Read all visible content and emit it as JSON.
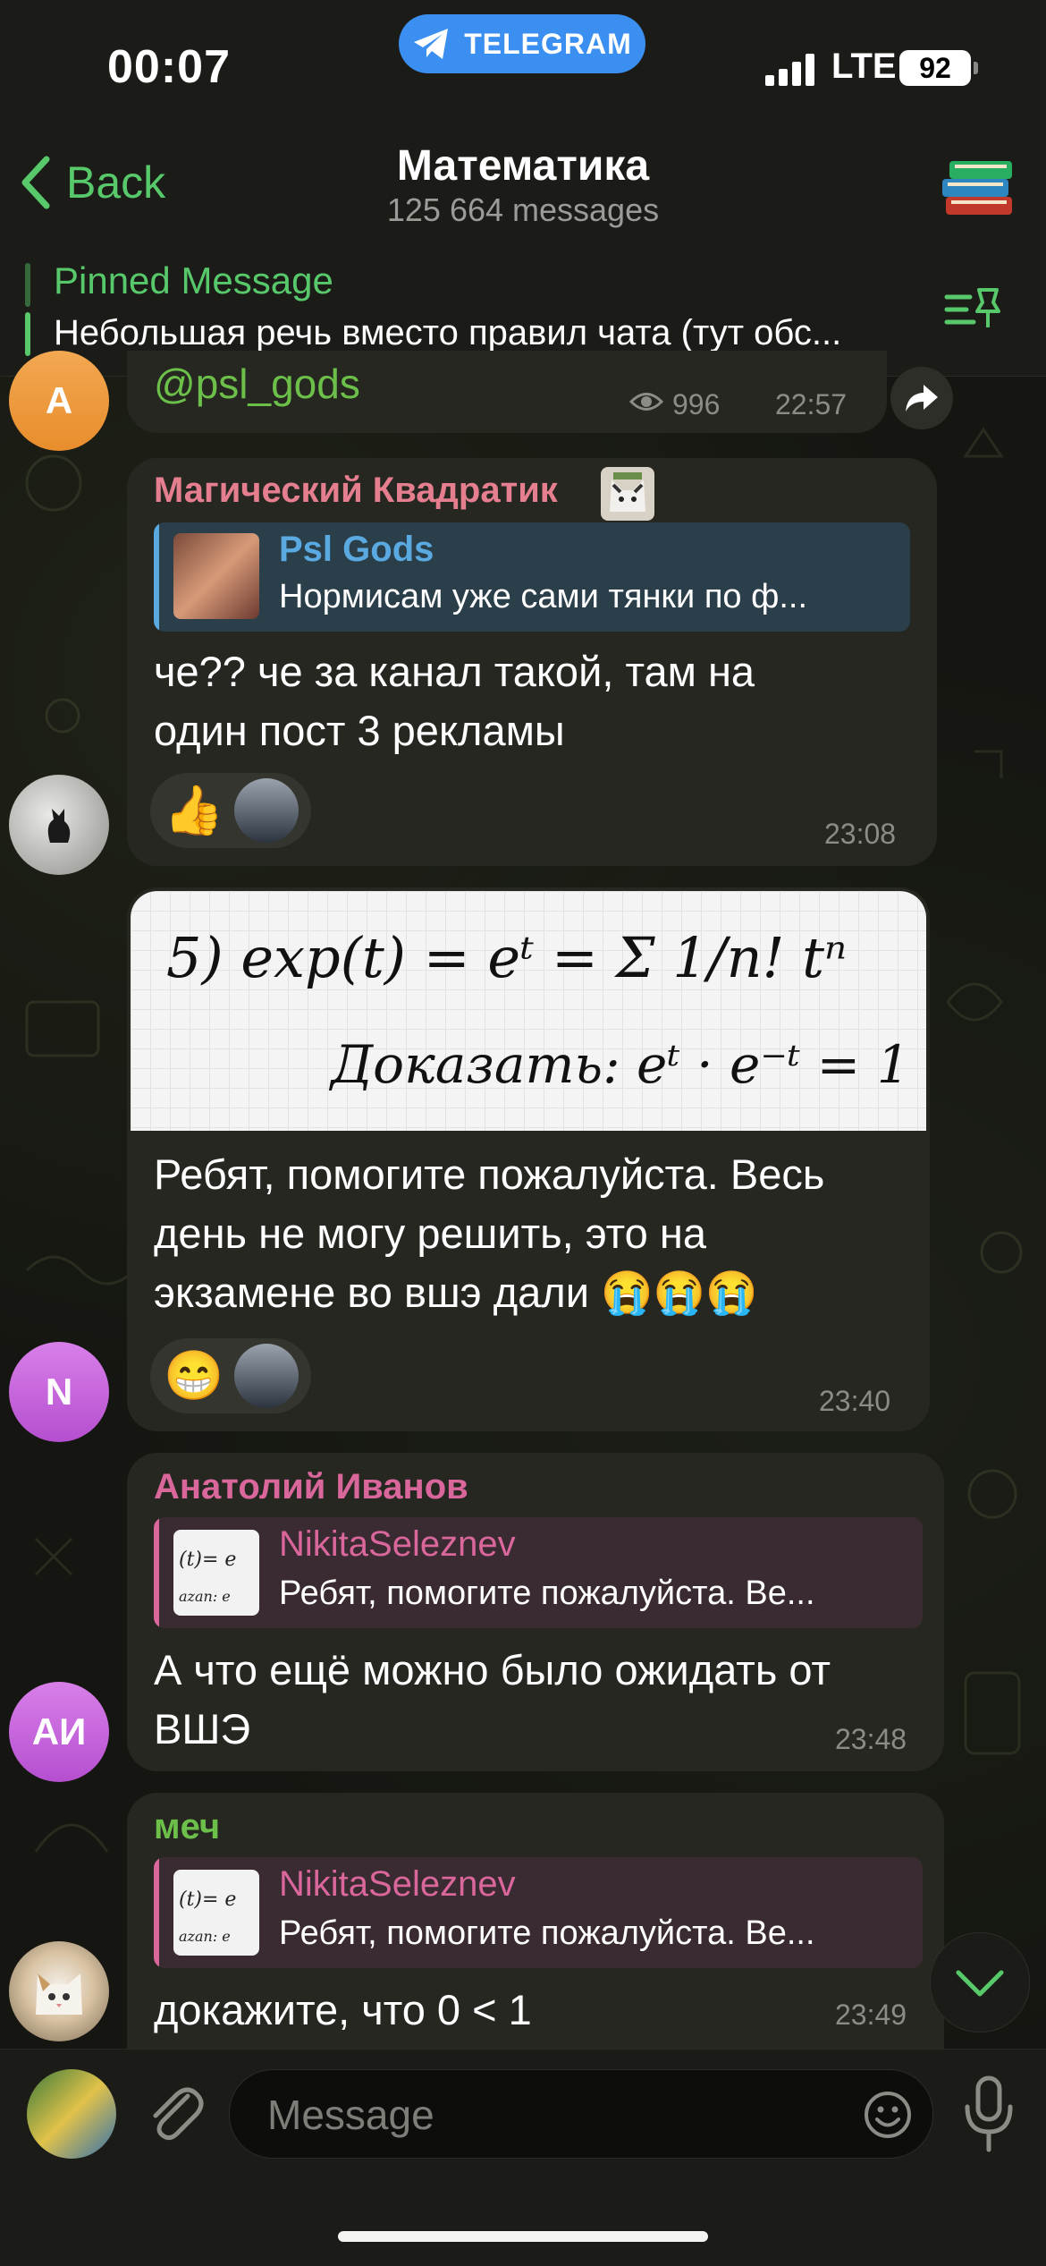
{
  "status_bar": {
    "time": "00:07",
    "app_pill": "TELEGRAM",
    "network": "LTE",
    "battery": "92"
  },
  "header": {
    "back_label": "Back",
    "title": "Математика",
    "subtitle": "125 664 messages"
  },
  "pinned": {
    "label": "Pinned Message",
    "text": "Небольшая речь вместо правил чата (тут обс..."
  },
  "messages": [
    {
      "channel": "@psl_gods",
      "views": "996",
      "time": "22:57",
      "avatar_letter": "A"
    },
    {
      "sender": "Магический Квадратик",
      "reply_name": "Psl Gods",
      "reply_text": "Нормисам уже сами тянки по ф...",
      "text_lines": [
        "че?? че за канал такой, там на",
        "один пост 3 рекламы"
      ],
      "reaction": "👍",
      "time": "23:08"
    },
    {
      "image_line1": "5)   exp(t) = eᵗ = Σ 1/n! tⁿ",
      "image_line2": "Доказать:  eᵗ · e⁻ᵗ = 1",
      "text_lines": [
        "Ребят, помогите пожалуйста. Весь",
        "день не могу решить, это на",
        "экзамене во вшэ дали 😭😭😭"
      ],
      "reaction": "😁",
      "avatar_letter": "N",
      "time": "23:40"
    },
    {
      "sender": "Анатолий Иванов",
      "reply_name": "NikitaSeleznev",
      "reply_text": "Ребят, помогите пожалуйста. Ве...",
      "text_lines": [
        "А что ещё можно было ожидать от",
        "ВШЭ"
      ],
      "avatar_letter": "АИ",
      "time": "23:48"
    },
    {
      "sender": "меч",
      "reply_name": "NikitaSeleznev",
      "reply_text": "Ребят, помогите пожалуйста. Ве...",
      "text_lines": [
        "докажите, что 0 < 1"
      ],
      "time": "23:49"
    }
  ],
  "input": {
    "placeholder": "Message"
  },
  "colors": {
    "accent_green": "#58c96b",
    "name_pink": "#e57f8f",
    "name_magenta": "#d9679b",
    "name_green": "#6cc04a",
    "reply_blue": "#5aa9e0",
    "bubble": "#262721"
  },
  "icons": [
    "telegram-icon",
    "back-chevron-icon",
    "books-icon",
    "pin-list-icon",
    "eye-icon",
    "share-icon",
    "attach-icon",
    "sticker-icon",
    "mic-icon",
    "scroll-down-icon"
  ]
}
